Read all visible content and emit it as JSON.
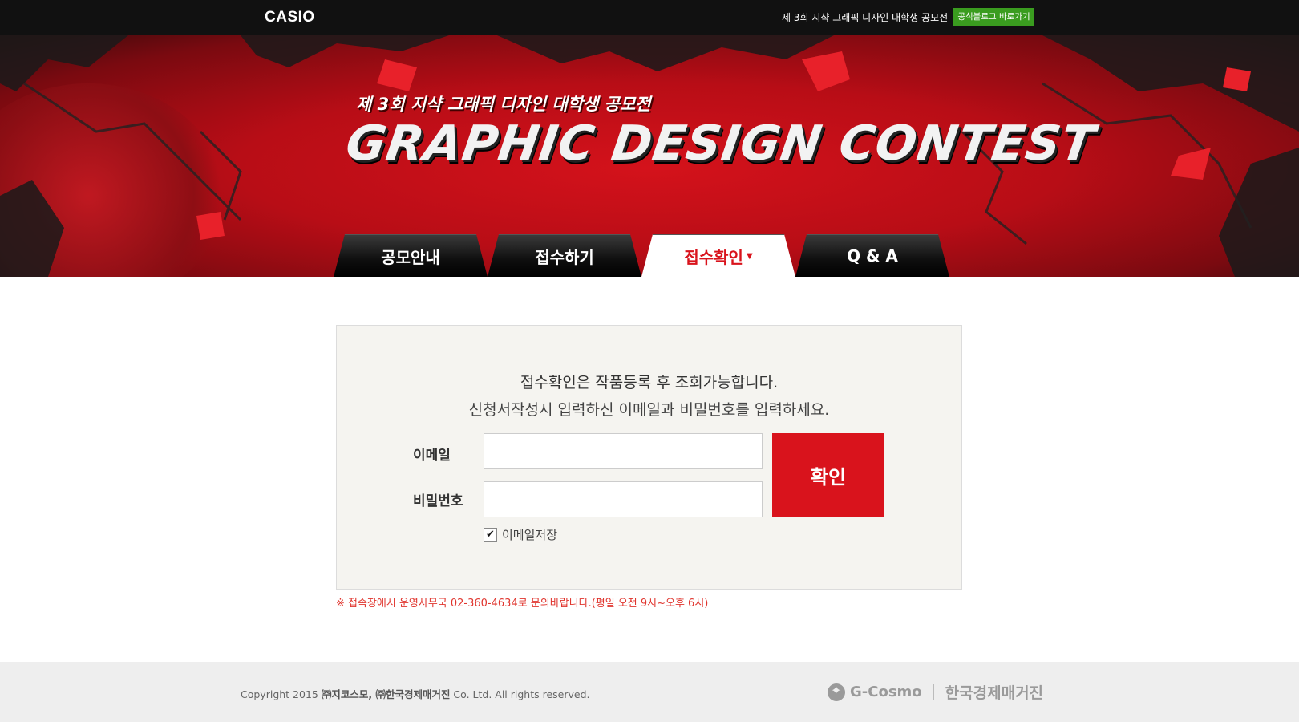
{
  "header": {
    "logo": "CASIO",
    "contest_title": "제 3회 지샥 그래픽 디자인 대학생 공모전",
    "blog_button": "공식블로그 바로가기"
  },
  "hero": {
    "subtitle": "제 3회 지샥 그래픽 디자인 대학생 공모전",
    "title": "GRAPHIC DESIGN CONTEST"
  },
  "tabs": [
    {
      "label": "공모안내",
      "active": false
    },
    {
      "label": "접수하기",
      "active": false
    },
    {
      "label": "접수확인",
      "active": true
    },
    {
      "label": "Q & A",
      "active": false
    }
  ],
  "form": {
    "message_line1": "접수확인은 작품등록 후 조회가능합니다.",
    "message_line2": "신청서작성시 입력하신 이메일과 비밀번호를 입력하세요.",
    "email_label": "이메일",
    "email_value": "",
    "password_label": "비밀번호",
    "password_value": "",
    "confirm_button": "확인",
    "remember_label": "이메일저장",
    "remember_checked": true
  },
  "notice": "※ 접속장애시 운영사무국 02-360-4634로 문의바랍니다.(평일 오전 9시~오후 6시)",
  "footer": {
    "copyright_prefix": "Copyright 2015 ",
    "company1": "㈜지코스모, ㈜한국경제매거진",
    "copyright_suffix": " Co. Ltd. All rights reserved.",
    "logo1": "G-Cosmo",
    "logo2": "한국경제매거진"
  },
  "colors": {
    "brand_red": "#d9131c",
    "blog_green": "#3a9c1f",
    "notice_red": "#e0352e"
  }
}
